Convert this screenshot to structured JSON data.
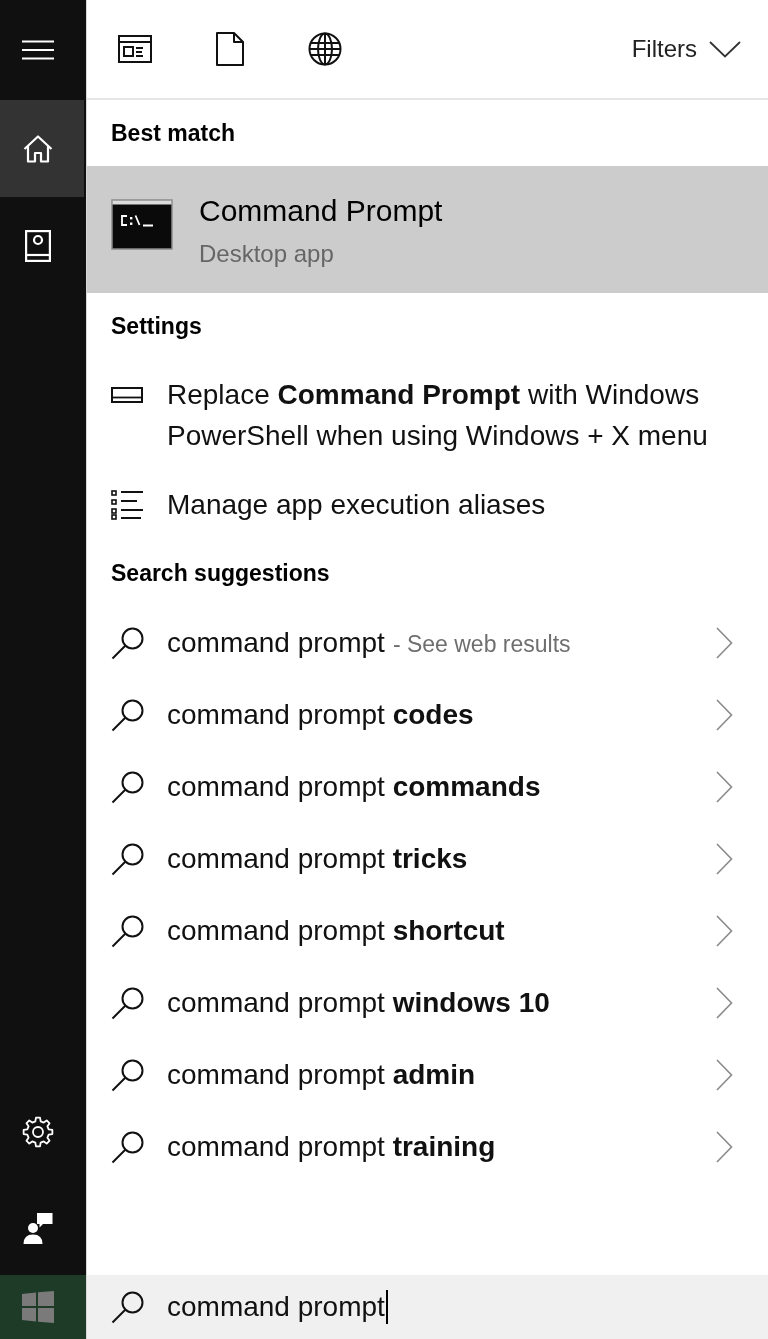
{
  "sidebar": {
    "items": [
      {
        "selected": true
      },
      {
        "selected": false
      }
    ]
  },
  "toolbar": {
    "filters": "Filters"
  },
  "best_match": {
    "heading": "Best match",
    "title": "Command Prompt",
    "subtitle": "Desktop app",
    "selected": true
  },
  "settings": {
    "heading": "Settings",
    "items": [
      {
        "text": "Replace **Command Prompt** with Windows PowerShell when using Windows + X menu"
      },
      {
        "text": "Manage app execution aliases"
      }
    ]
  },
  "suggestions": {
    "heading": "Search suggestions",
    "items": [
      {
        "text": "command prompt",
        "hint": "- See web results"
      },
      {
        "text": "command prompt **codes**"
      },
      {
        "text": "command prompt **commands**"
      },
      {
        "text": "command prompt **tricks**"
      },
      {
        "text": "command prompt **shortcut**"
      },
      {
        "text": "command prompt **windows 10**"
      },
      {
        "text": "command prompt **admin**"
      },
      {
        "text": "command prompt **training**"
      }
    ]
  },
  "search": {
    "value": "command prompt"
  }
}
